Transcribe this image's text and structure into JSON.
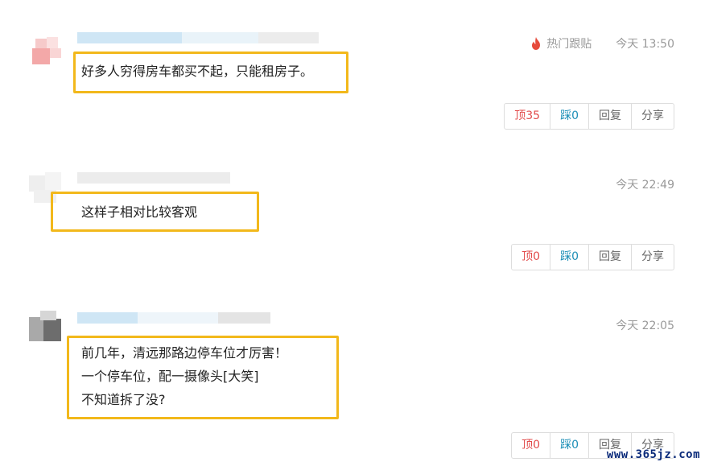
{
  "comments": [
    {
      "hot_label": "热门跟贴",
      "time": "今天 13:50",
      "lines": [
        "好多人穷得房车都买不起，只能租房子。"
      ],
      "actions": {
        "up": "顶35",
        "down": "踩0",
        "reply": "回复",
        "share": "分享"
      }
    },
    {
      "time": "今天 22:49",
      "lines": [
        "这样子相对比较客观"
      ],
      "actions": {
        "up": "顶0",
        "down": "踩0",
        "reply": "回复",
        "share": "分享"
      }
    },
    {
      "time": "今天 22:05",
      "lines": [
        "前几年，清远那路边停车位才厉害！",
        "一个停车位，配一摄像头[大笑]",
        "不知道拆了没?"
      ],
      "actions": {
        "up": "顶0",
        "down": "踩0",
        "reply": "回复",
        "share": "分享"
      }
    }
  ],
  "watermark": "www.365jz.com",
  "colors": {
    "highlight_border": "#f2b81b",
    "up": "#e24c4c",
    "down": "#1d8fb7",
    "hot_icon": "#e64a3b"
  }
}
